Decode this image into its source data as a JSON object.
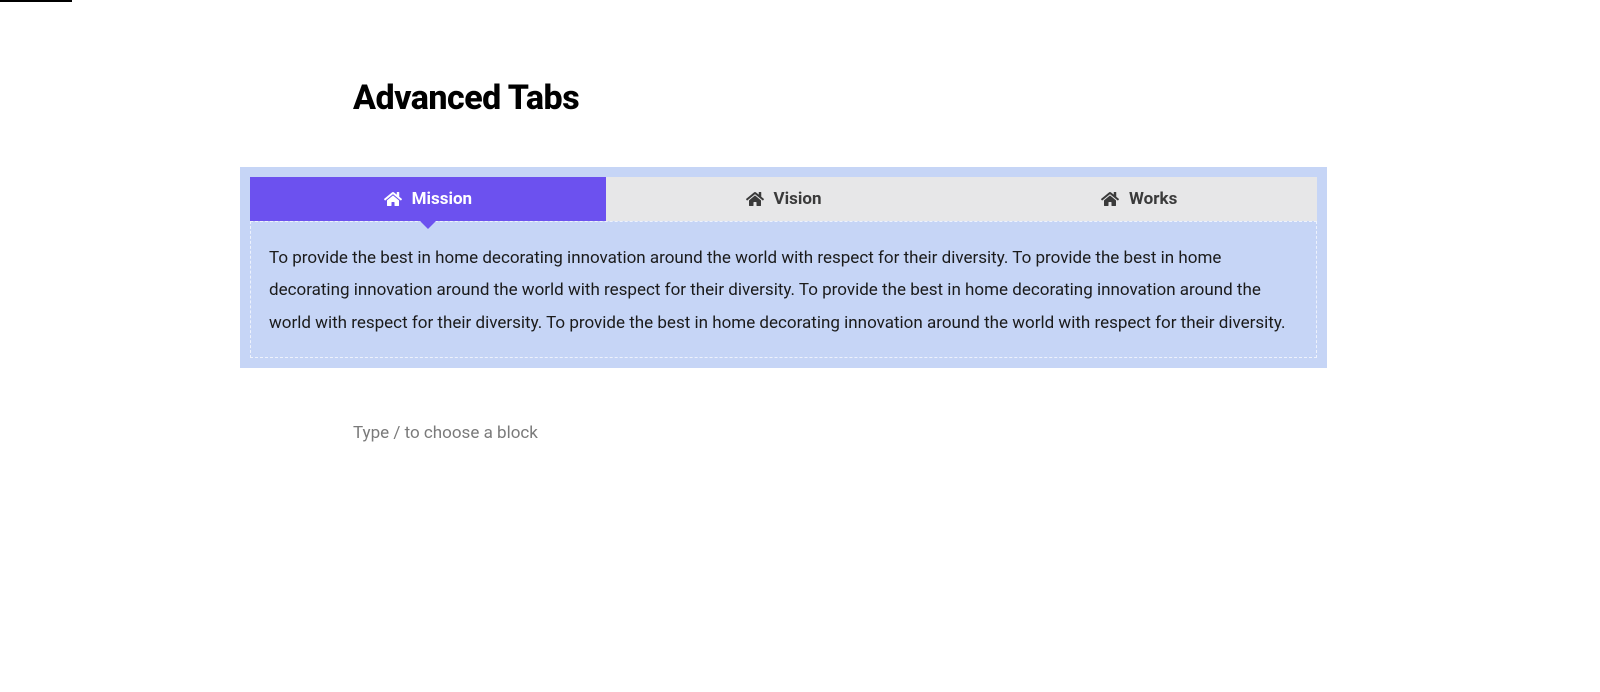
{
  "heading": "Advanced Tabs",
  "tabs": {
    "active_color": "#6c51ef",
    "inactive_bg": "#e7e7e8",
    "widget_bg": "#c6d5f6",
    "items": [
      {
        "label": "Mission",
        "icon": "home-icon",
        "active": true
      },
      {
        "label": "Vision",
        "icon": "home-icon",
        "active": false
      },
      {
        "label": "Works",
        "icon": "home-icon",
        "active": false
      }
    ],
    "content": "To provide the best in home decorating innovation around the world with respect for their diversity. To provide the best in home decorating innovation around the world with respect for their diversity. To provide the best in home decorating innovation around the world with respect for their diversity. To provide the best in home decorating innovation around the world with respect for their diversity."
  },
  "placeholder": "Type / to choose a block"
}
